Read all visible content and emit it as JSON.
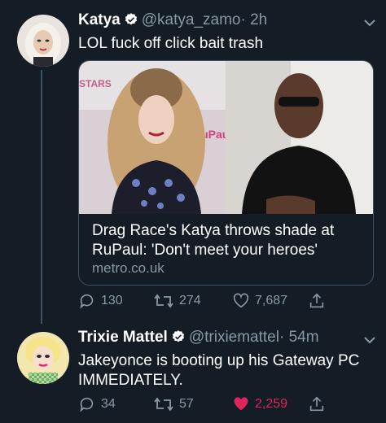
{
  "tweet1": {
    "name": "Katya",
    "handle": "@katya_zamo",
    "time": "· 2h",
    "text": "LOL fuck off click bait trash",
    "card": {
      "title": "Drag Race's Katya throws shade at RuPaul: 'Don't meet your heroes'",
      "domain": "metro.co.uk"
    },
    "actions": {
      "replies": "130",
      "retweets": "274",
      "likes": "7,687"
    }
  },
  "tweet2": {
    "name": "Trixie Mattel",
    "handle": "@trixiemattel",
    "time": "· 54m",
    "text": "Jakeyonce is booting up his Gateway PC IMMEDIATELY.",
    "actions": {
      "replies": "34",
      "retweets": "57",
      "likes": "2,259"
    }
  },
  "colors": {
    "background": "#141d26",
    "secondary_text": "#8899a6",
    "verified_blue": "#1da1f2",
    "like_red": "#e0245e"
  },
  "icons": [
    "verified-badge-icon",
    "chevron-down-icon",
    "reply-icon",
    "retweet-icon",
    "heart-icon",
    "share-icon"
  ]
}
